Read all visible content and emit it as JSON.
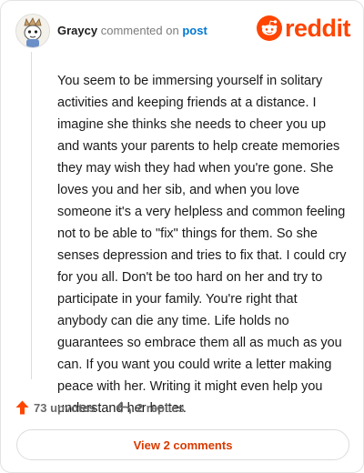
{
  "comment": {
    "username": "Graycy",
    "action_text": "commented on",
    "post_link": "post",
    "body": "You seem to be immersing yourself in solitary activities and keeping friends at a distance. I imagine she thinks she needs to cheer you up and wants your parents to help create memories they may wish they had when you're gone. She loves you and her sib, and when you love someone it's a very helpless and common feeling not to be able to \"fix\" things for them. So she senses depression and tries to fix that. I could cry for you all. Don't be too hard on her and try to participate in your family. You're right that anybody can die any time. Life holds no guarantees so embrace them all as much as you can. If you want you could write a letter making peace with her. Writing it might even help you understand her better.",
    "upvotes": "73 upvotes",
    "replies": "2 replies"
  },
  "brand": {
    "wordmark": "reddit",
    "color": "#ff4500"
  },
  "footer": {
    "view_comments_label": "View 2 comments"
  },
  "icons": {
    "upvote": "upvote-arrow-icon",
    "reply": "reply-arrow-icon",
    "logo": "reddit-snoo-icon",
    "avatar": "user-avatar"
  }
}
